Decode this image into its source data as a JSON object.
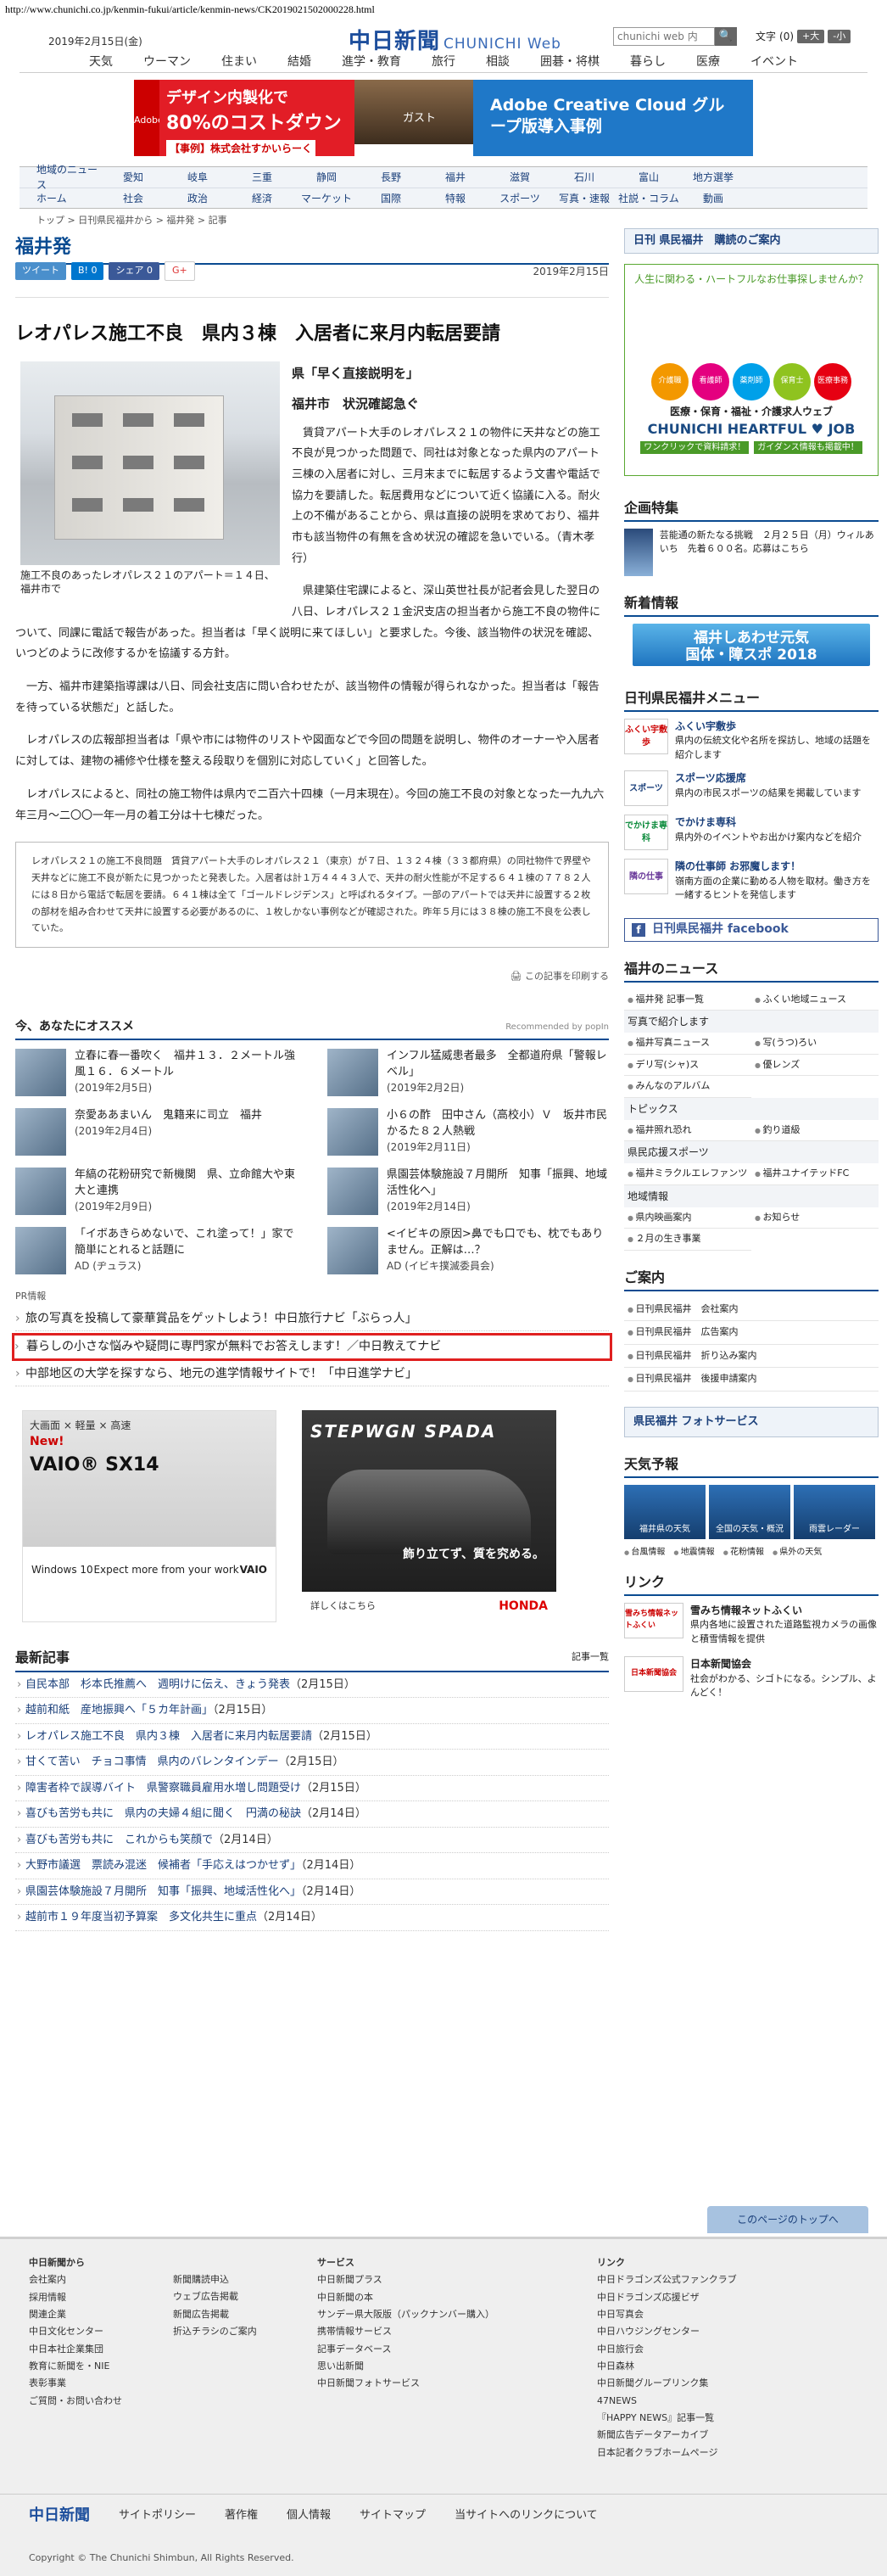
{
  "url": "http://www.chunichi.co.jp/kenmin-fukui/article/kenmin-news/CK2019021502000228.html",
  "header": {
    "date": "2019年2月15日(金)",
    "logo": "中日新聞",
    "logo_sub": "CHUNICHI Web",
    "search_placeholder": "chunichi web 内",
    "search_btn": "🔍",
    "fontsize_label": "文字",
    "fontsize_val": "(0)",
    "bigger": "+大",
    "smaller": "-小"
  },
  "gnav": [
    "天気",
    "ウーマン",
    "住まい",
    "結婚",
    "進学・教育",
    "旅行",
    "相談",
    "囲碁・将棋",
    "暮らし",
    "医療",
    "イベント"
  ],
  "banner": {
    "adobe": "Adobe",
    "l1": "デザイン内製化で",
    "l2": "80%のコストダウン",
    "l3": "【事例】株式会社すかいらーく",
    "brand": "ガスト",
    "r": "Adobe Creative Cloud グループ版導入事例"
  },
  "subnav": {
    "row1": [
      "地域のニュース",
      "愛知",
      "岐阜",
      "三重",
      "静岡",
      "長野",
      "福井",
      "滋賀",
      "石川",
      "富山",
      "地方選挙"
    ],
    "row2": [
      "ホーム",
      "社会",
      "政治",
      "経済",
      "マーケット",
      "国際",
      "特報",
      "スポーツ",
      "写真・速報",
      "社説・コラム",
      "動画"
    ]
  },
  "crumb": "トップ > 日刊県民福井から > 福井発 > 記事",
  "section": "福井発",
  "share": {
    "tweet": "ツイート",
    "hatena": "B! 0",
    "fb": "シェア 0",
    "gplus": "G+",
    "date": "2019年2月15日"
  },
  "article": {
    "headline": "レオパレス施工不良　県内３棟　入居者に来月内転居要請",
    "caption": "施工不良のあったレオパレス２１のアパート＝１４日、福井市で",
    "subhead1": "県「早く直接説明を」",
    "subhead2": "福井市　状況確認急ぐ",
    "p1": "賃貸アパート大手のレオパレス２１の物件に天井などの施工不良が見つかった問題で、同社は対象となった県内のアパート三棟の入居者に対し、三月末までに転居するよう文書や電話で協力を要請した。転居費用などについて近く協議に入る。耐火上の不備があることから、県は直接の説明を求めており、福井市も該当物件の有無を含め状況の確認を急いでいる。（青木孝行）",
    "p2": "県建築住宅課によると、深山英世社長が記者会見した翌日の八日、レオパレス２１金沢支店の担当者から施工不良の物件について、同課に電話で報告があった。担当者は「早く説明に来てほしい」と要求した。今後、該当物件の状況を確認、いつどのように改修するかを協議する方針。",
    "p3": "一方、福井市建築指導課は八日、同会社支店に問い合わせたが、該当物件の情報が得られなかった。担当者は「報告を待っている状態だ」と話した。",
    "p4": "レオパレスの広報部担当者は「県や市には物件のリストや図面などで今回の問題を説明し、物件のオーナーや入居者に対しては、建物の補修や仕様を整える段取りを個別に対応していく」と回答した。",
    "p5": "レオパレスによると、同社の施工物件は県内で二百六十四棟（一月末現在）。今回の施工不良の対象となった一九九六年三月～二〇〇一年一月の着工分は十七棟だった。",
    "note": "レオパレス２１の施工不良問題　賃貸アパート大手のレオパレス２１（東京）が７日、１３２４棟（３３都府県）の同社物件で界壁や天井などに施工不良が新たに見つかったと発表した。入居者は計１万４４４３人で、天井の耐火性能が不足する６４１棟の７７８２人には８日から電話で転居を要請。６４１棟は全て「ゴールドレジデンス」と呼ばれるタイプ。一部のアパートでは天井に設置する２枚の部材を組み合わせて天井に設置する必要があるのに、１枚しかない事例などが確認された。昨年５月には３８棟の施工不良を公表していた。",
    "print": "この記事を印刷する"
  },
  "recommend": {
    "title": "今、あなたにオススメ",
    "powered": "Recommended by popIn",
    "items": [
      {
        "t": "立春に春一番吹く　福井１３．２メートル強風１６．６メートル",
        "d": "(2019年2月5日)"
      },
      {
        "t": "インフル猛威患者最多　全都道府県「警報レベル」",
        "d": "(2019年2月2日)"
      },
      {
        "t": "奈愛ああまいん　鬼籍来に司立　福井",
        "d": "(2019年2月4日)"
      },
      {
        "t": "小６の酢　田中さん（高校小）Ｖ　坂井市民かるた８２人熱戦",
        "d": "(2019年2月11日)"
      },
      {
        "t": "年縞の花粉研究で新機関　県、立命館大や東大と連携",
        "d": "(2019年2月9日)"
      },
      {
        "t": "県園芸体験施設７月開所　知事「振興、地域活性化へ」",
        "d": "(2019年2月14日)"
      },
      {
        "t": "「イボあきらめないで、これ塗って！」家で簡単にとれると話題に",
        "d": "AD (ヂュラス)"
      },
      {
        "t": "<イビキの原因>鼻でも口でも、枕でもありません。正解は…？",
        "d": "AD (イビキ撲滅委員会)"
      }
    ]
  },
  "pr": {
    "label": "PR情報",
    "items": [
      "旅の写真を投稿して豪華賞品をゲットしよう！中日旅行ナビ「ぶらっ人」",
      "暮らしの小さな悩みや疑問に専門家が無料でお答えします！／中日教えてナビ",
      "中部地区の大学を探すなら、地元の進学情報サイトで！「中日進学ナビ」"
    ]
  },
  "ad1": {
    "hdr": "大画面 × 軽量 × 高速",
    "n": "New!",
    "model": "VAIO® SX14",
    "win": "Windows 10",
    "more": "Expect more from your work",
    "brand": "VAIO"
  },
  "ad2": {
    "name": "STEPWGN SPADA",
    "tag": "飾り立てず、質を究める。",
    "more": "詳しくはこちら",
    "brand": "HONDA"
  },
  "latest": {
    "title": "最新記事",
    "more": "記事一覧",
    "items": [
      {
        "t": "自民本部　杉本氏推薦へ　週明けに伝え、きょう発表",
        "d": "（2月15日）"
      },
      {
        "t": "越前和紙　産地振興へ「５カ年計画」",
        "d": "（2月15日）"
      },
      {
        "t": "レオパレス施工不良　県内３棟　入居者に来月内転居要請",
        "d": "（2月15日）"
      },
      {
        "t": "甘くて苦い　チョコ事情　県内のバレンタインデー",
        "d": "（2月15日）"
      },
      {
        "t": "障害者枠で誤導バイト　県警察職員雇用水増し問題受け",
        "d": "（2月15日）"
      },
      {
        "t": "喜びも苦労も共に　県内の夫婦４組に聞く　円満の秘訣",
        "d": "（2月14日）"
      },
      {
        "t": "喜びも苦労も共に　これからも笑顔で",
        "d": "（2月14日）"
      },
      {
        "t": "大野市議選　票読み混迷　候補者「手応えはつかせず」",
        "d": "（2月14日）"
      },
      {
        "t": "県園芸体験施設７月開所　知事「振興、地域活性化へ」",
        "d": "（2月14日）"
      },
      {
        "t": "越前市１９年度当初予算案　多文化共生に重点",
        "d": "（2月14日）"
      }
    ]
  },
  "side": {
    "koudoku": "日刊 県民福井　購読のご案内",
    "heart": {
      "t1": "人生に関わる・ハートフルなお仕事探しませんか？",
      "circles": [
        "介護職",
        "看護師",
        "薬剤師",
        "保育士",
        "医療事務"
      ],
      "t2": "医療・保育・福祉・介護求人ウェブ",
      "t3": "CHUNICHI HEARTFUL ♥ JOB",
      "t4a": "ワンクリックで資料請求！",
      "t4b": "ガイダンス情報も掲載中！"
    },
    "kikaku": {
      "title": "企画特集",
      "t": "芸能通の新たなる挑戦　２月２５日（月）ウィルあいち　先着６００名。応募はこちら"
    },
    "shinchaku": {
      "title": "新着情報",
      "b1": "福井しあわせ元気",
      "b2": "国体・障スポ 2018"
    },
    "menu": {
      "title": "日刊県民福井メニュー",
      "items": [
        {
          "th": "ふくい宇敷歩",
          "h": "ふくい宇敷歩",
          "t": "県内の伝統文化や名所を探訪し、地域の話題を紹介します"
        },
        {
          "th": "スポーツ",
          "h": "スポーツ応援席",
          "t": "県内の市民スポーツの結果を掲載しています"
        },
        {
          "th": "でかけま専科",
          "h": "でかけま専科",
          "t": "県内外のイベントやお出かけ案内などを紹介"
        },
        {
          "th": "隣の仕事",
          "h": "隣の仕事師 お邪魔します！",
          "t": "嶺南方面の企業に勤める人物を取材。働き方を一緒するヒントを発信します"
        }
      ]
    },
    "fb": "日刊県民福井 facebook",
    "news": {
      "title": "福井のニュース",
      "a": [
        "福井発 記事一覧",
        "ふくい地域ニュース"
      ],
      "s1": "写真で紹介します",
      "b": [
        "福井写真ニュース",
        "写(うつ)ろい",
        "デリ写(シャ)ス",
        "優レンズ",
        "みんなのアルバム",
        ""
      ],
      "s2": "トピックス",
      "c": [
        "福井照れ恐れ",
        "釣り道級"
      ],
      "s3": "県民応援スポーツ",
      "d": [
        "福井ミラクルエレファンツ",
        "福井ユナイテッドFC"
      ],
      "s4": "地域情報",
      "e": [
        "県内映画案内",
        "お知らせ",
        "２月の生き事業",
        ""
      ]
    },
    "annai": {
      "title": "ご案内",
      "items": [
        "日刊県民福井　会社案内",
        "日刊県民福井　広告案内",
        "日刊県民福井　折り込み案内",
        "日刊県民福井　後援申請案内"
      ]
    },
    "photo": "県民福井 フォトサービス",
    "weather": {
      "title": "天気予報",
      "a": "福井県の天気",
      "b": "全国の天気・概況",
      "c": "雨雲レーダー",
      "links": [
        "台風情報",
        "地震情報",
        "花粉情報",
        "県外の天気"
      ]
    },
    "link": {
      "title": "リンク",
      "items": [
        {
          "th": "雪みち情報ネットふくい",
          "h": "雪みち情報ネットふくい",
          "t": "県内各地に設置された道路監視カメラの画像と積雪情報を提供"
        },
        {
          "th": "日本新聞協会",
          "h": "日本新聞協会",
          "t": "社会がわかる、シゴトになる。シンプル、よんどく！"
        }
      ]
    }
  },
  "totop": "このページのトップへ",
  "footer": {
    "c1h": "中日新聞から",
    "c1": [
      "会社案内",
      "採用情報",
      "関連企業",
      "中日文化センター",
      "中日本社企業集団",
      "教育に新聞を・NIE",
      "表彰事業",
      "ご質問・お問い合わせ"
    ],
    "c2": [
      "新聞購読申込",
      "ウェブ広告掲載",
      "新聞広告掲載",
      "折込チラシのご案内"
    ],
    "c3h": "サービス",
    "c3": [
      "中日新聞プラス",
      "中日新聞の本",
      "サンデー県大阪版（パックナンバー購入）",
      "携帯情報サービス",
      "記事データベース",
      "思い出新聞",
      "中日新聞フォトサービス"
    ],
    "c4h": "リンク",
    "c4": [
      "中日ドラゴンズ公式ファンクラブ",
      "中日ドラゴンズ応援ビザ",
      "中日写真会",
      "中日ハウジングセンター",
      "中日旅行会",
      "中日森林",
      "中日新聞グループリンク集",
      "47NEWS",
      "『HAPPY NEWS』記事一覧",
      "新聞広告データアーカイブ",
      "日本記者クラブホームページ"
    ],
    "bar": [
      "中日新聞",
      "サイトポリシー",
      "著作権",
      "個人情報",
      "サイトマップ",
      "当サイトへのリンクについて"
    ],
    "copy": "Copyright © The Chunichi Shimbun, All Rights Reserved."
  }
}
